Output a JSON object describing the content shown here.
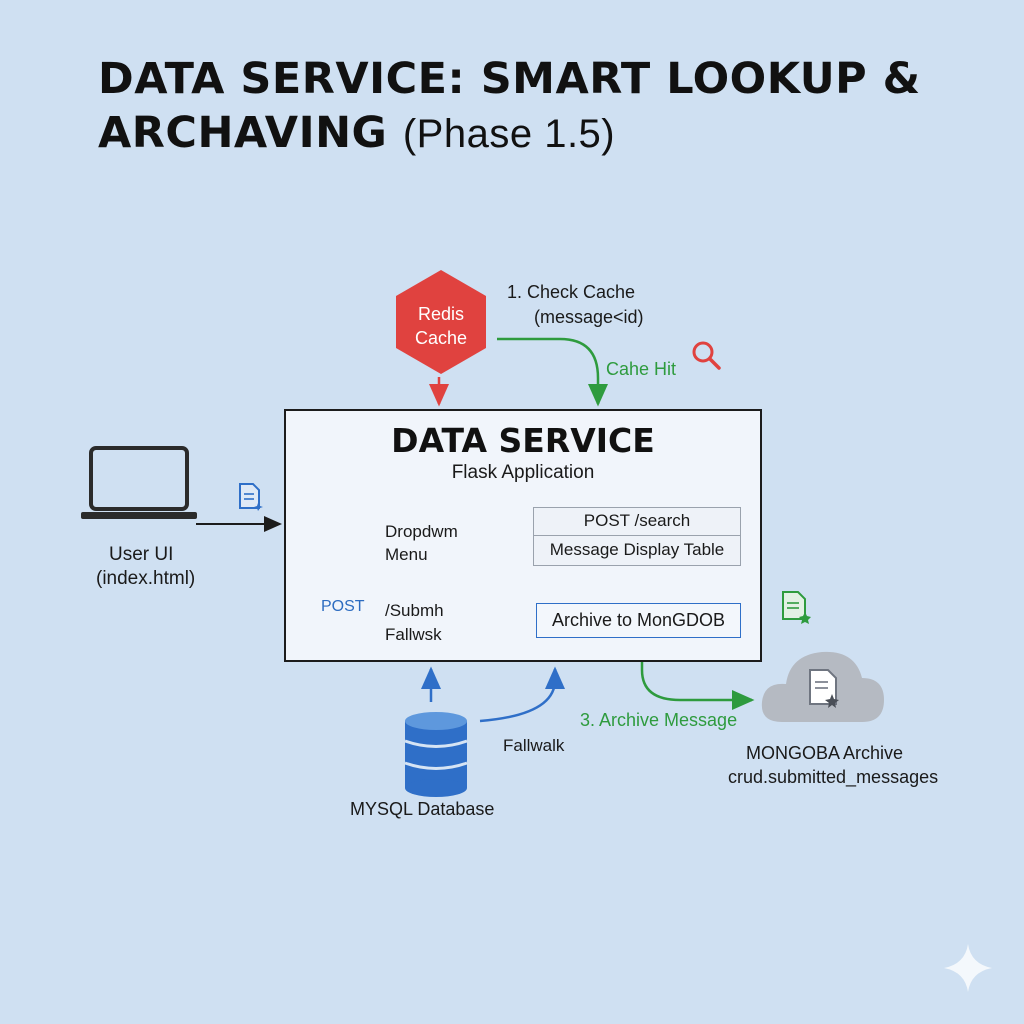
{
  "title": {
    "main": "DATA SERVICE: SMART LOOKUP & ARCHAVING",
    "sub": "(Phase 1.5)"
  },
  "redis": {
    "label_line1": "Redis",
    "label_line2": "Cache"
  },
  "flow": {
    "check_cache_line1": "1. Check Cache",
    "check_cache_line2": "(message<id)",
    "cache_hit": "Cahe Hit",
    "fallback": "Fallwalk",
    "archive_message": "3. Archive Message"
  },
  "service": {
    "title": "DATA SERVICE",
    "subtitle": "Flask Application",
    "dropdown_line1": "Dropdwm",
    "dropdown_line2": "Menu",
    "post_search": "POST /search",
    "message_table": "Message Display Table",
    "post_badge": "POST",
    "submit_line1": "/Submh",
    "submit_line2": "Fallwsk",
    "archive_button": "Archive to MonGDOB"
  },
  "user": {
    "line1": "User UI",
    "line2": "(index.html)"
  },
  "mysql": {
    "label": "MYSQL Database"
  },
  "mongo": {
    "line1": "MONGOBA Archive",
    "line2": "crud.submitted_messages"
  },
  "colors": {
    "background": "#cfe0f2",
    "redis": "#e0423f",
    "accent_blue": "#2f6fc8",
    "green": "#2e9b3e",
    "cloud": "#b5bac2"
  },
  "icons": [
    "laptop-icon",
    "document-icon",
    "magnifier-icon",
    "dropdown-icon",
    "database-icon",
    "cloud-icon",
    "document-star-icon",
    "sparkle-icon"
  ]
}
